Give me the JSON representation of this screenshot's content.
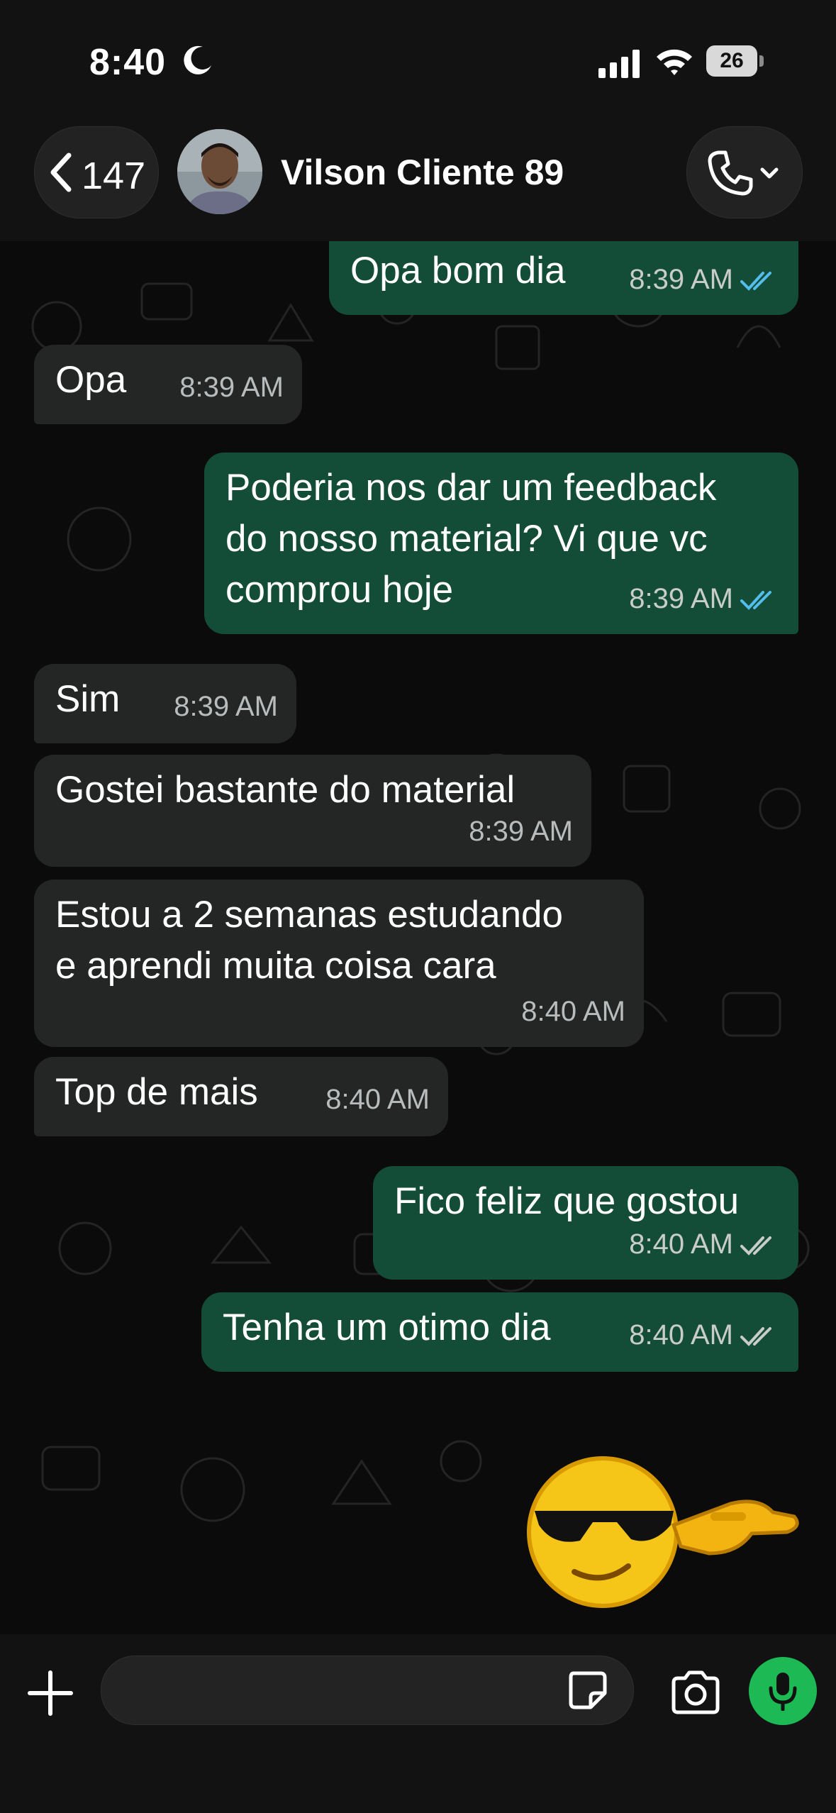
{
  "status_bar": {
    "time": "8:40",
    "battery": "26"
  },
  "header": {
    "back_count": "147",
    "contact_name": "Vilson Cliente 89"
  },
  "messages": [
    {
      "dir": "out",
      "text": "Opa bom dia",
      "time": "8:39 AM",
      "status": "read"
    },
    {
      "dir": "in",
      "text": "Opa",
      "time": "8:39 AM"
    },
    {
      "dir": "out",
      "text": "Poderia nos dar um feedback\ndo nosso material? Vi que vc\ncomprou hoje",
      "time": "8:39 AM",
      "status": "read"
    },
    {
      "dir": "in",
      "text": "Sim",
      "time": "8:39 AM"
    },
    {
      "dir": "in",
      "text": "Gostei bastante do material",
      "time": "8:39 AM"
    },
    {
      "dir": "in",
      "text": "Estou a 2 semanas estudando\ne aprendi muita coisa cara",
      "time": "8:40 AM"
    },
    {
      "dir": "in",
      "text": "Top de mais",
      "time": "8:40 AM"
    },
    {
      "dir": "out",
      "text": "Fico feliz que gostou",
      "time": "8:40 AM",
      "status": "delivered"
    },
    {
      "dir": "out",
      "text": "Tenha um otimo dia",
      "time": "8:40 AM",
      "status": "delivered"
    }
  ],
  "sticker": {
    "icon": "cool-sunglasses-emoji-sticker"
  },
  "colors": {
    "read_ticks": "#53bdeb",
    "delivered_ticks": "#c8cdc9",
    "mic": "#1db954",
    "out_bubble": "#144d37",
    "in_bubble": "#242626"
  }
}
